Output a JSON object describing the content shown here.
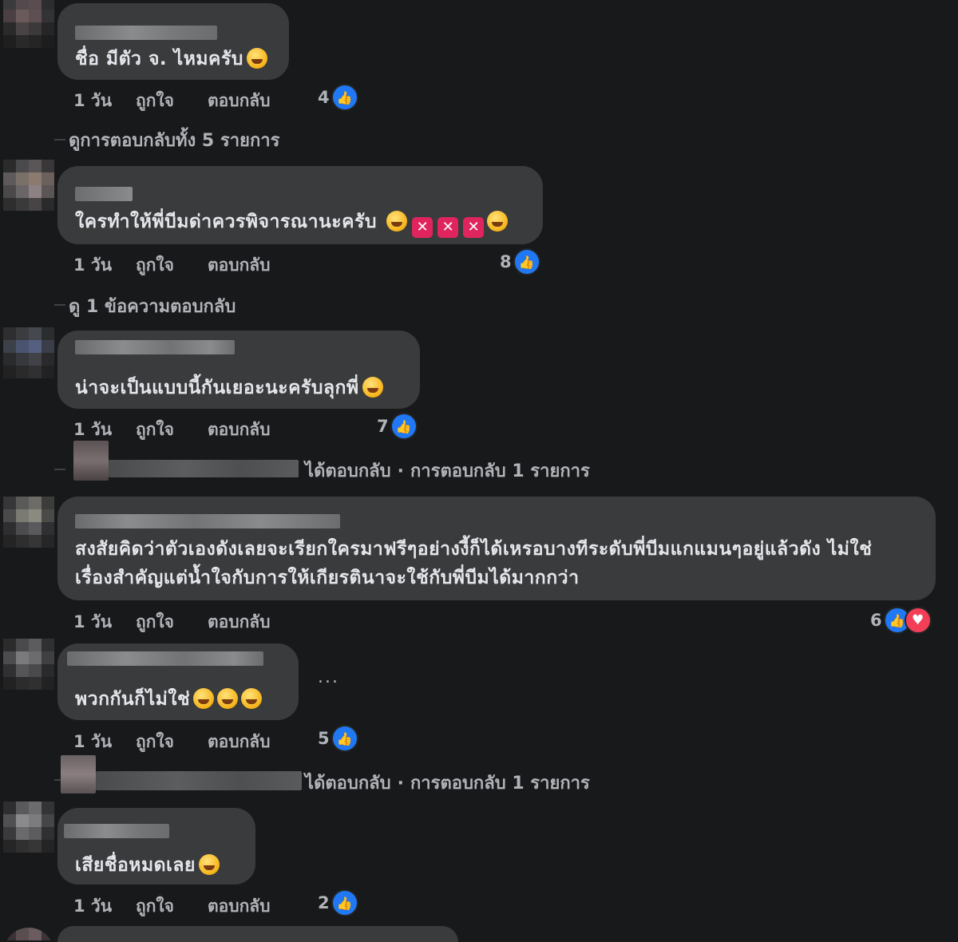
{
  "actions": {
    "time": "1 วัน",
    "like": "ถูกใจ",
    "reply": "ตอบกลับ"
  },
  "comments": [
    {
      "text": "ชื่อ มีตัว จ. ไหมครับ",
      "emojis": [
        "grin-sweat"
      ],
      "reactions": "4"
    },
    {
      "text": "ใครทำให้พี่บีมด่าควรพิจารณานะครับ",
      "emojis": [
        "grin",
        "x",
        "x",
        "x",
        "laugh"
      ],
      "reactions": "8"
    },
    {
      "text": "น่าจะเป็นแบบนี้กันเยอะนะครับลุกพี่",
      "emojis": [
        "rofl"
      ],
      "reactions": "7"
    },
    {
      "text": "สงสัยคิดว่าตัวเองดังเลยจะเรียกใครมาฟรีๆอย่างงี้ก็ได้เหรอบางทีระดับพี่บีมแกแมนๆอยู่แล้วดัง ไม่ใช่เรื่องสำคัญแต่น้ำใจกับการให้เกียรตินาจะใช้กับพี่บีมได้มากกว่า",
      "emojis": [],
      "reactions": "6"
    },
    {
      "text": "พวกกันก็ไม่ใช่",
      "emojis": [
        "grin-sweat",
        "grin-sweat",
        "grin-sweat"
      ],
      "reactions": "5"
    },
    {
      "text": "เสียชื่อหมดเลย",
      "emojis": [
        "rofl"
      ],
      "reactions": "2"
    }
  ],
  "view_replies_1": "ดูการตอบกลับทั้ง 5 รายการ",
  "view_replies_2": "ดู 1 ข้อความตอบกลับ",
  "reply_summary": {
    "replied": "ได้ตอบกลับ",
    "separator": "·",
    "count_text": "การตอบกลับ 1 รายการ"
  },
  "more_menu": "...",
  "colors": {
    "background": "#18191a",
    "bubble": "#3a3b3c",
    "like": "#2078f4",
    "love": "#f33e58",
    "secondary_text": "#b0b3b8"
  }
}
